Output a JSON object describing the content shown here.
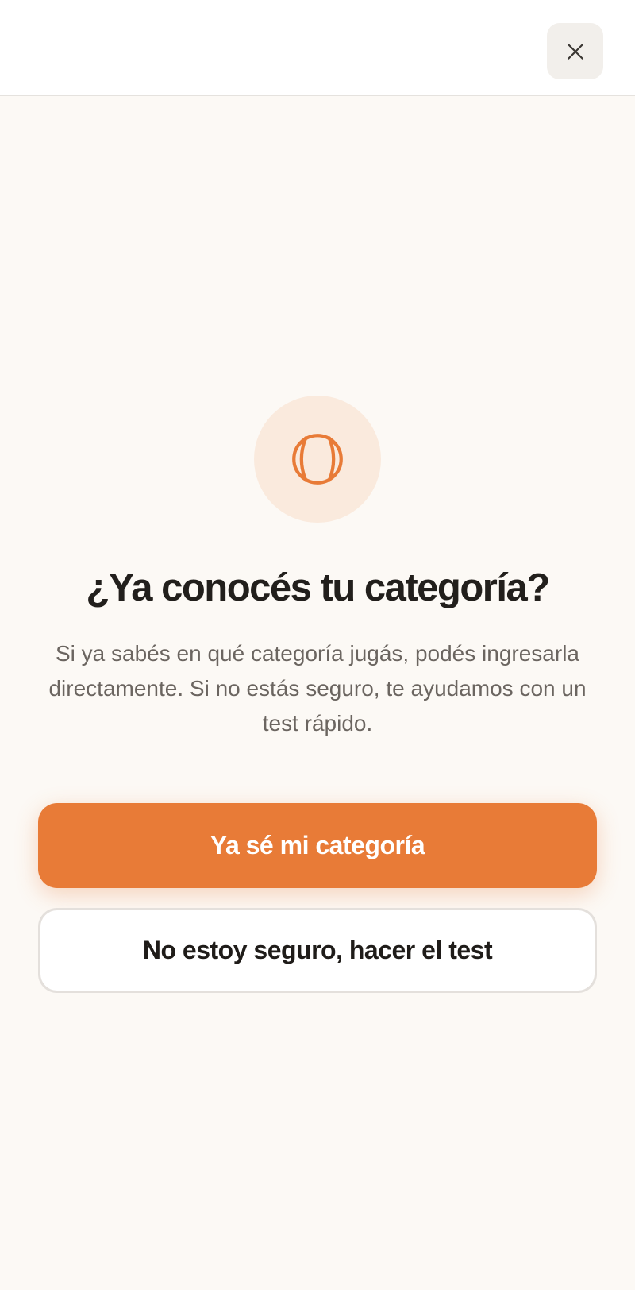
{
  "header": {
    "close_icon": "close-icon"
  },
  "main": {
    "icon": "tennis-ball-icon",
    "title": "¿Ya conocés tu categoría?",
    "subtitle": "Si ya sabés en qué categoría jugás, podés ingresarla directamente. Si no estás seguro, te ayudamos con un test rápido.",
    "primary_button_label": "Ya sé mi categoría",
    "secondary_button_label": "No estoy seguro, hacer el test"
  },
  "colors": {
    "accent": "#e87b37",
    "accent_soft": "#faeadd",
    "background": "#fcf9f5",
    "title_text": "#221f1c",
    "body_text": "#6b6560"
  }
}
